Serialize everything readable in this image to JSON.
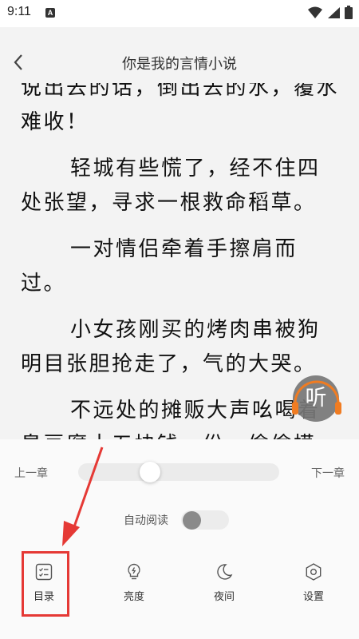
{
  "status_bar": {
    "time": "9:11",
    "notification_letter": "A",
    "icons": [
      "wifi-icon",
      "signal-icon",
      "battery-icon"
    ]
  },
  "header": {
    "title": "你是我的言情小说",
    "back_icon": "chevron-left-icon"
  },
  "reader": {
    "paragraphs": [
      "说出去的话，倒出去的水，覆水难收！",
      "轻城有些慌了，经不住四处张望，寻求一根救命稻草。",
      "一对情侣牵着手擦肩而过。",
      "小女孩刚买的烤肉串被狗明目张胆抢走了，气的大哭。",
      "不远处的摊贩大声吆喝着臭豆腐十五块钱一份，偷偷摸"
    ]
  },
  "listen_button": {
    "label": "听",
    "accent_color": "#f07c22"
  },
  "panel": {
    "prev_chapter": "上一章",
    "next_chapter": "下一章",
    "progress": 0.34,
    "auto_read_label": "自动阅读",
    "auto_read_enabled": false
  },
  "toolbar": {
    "items": [
      {
        "label": "目录",
        "icon": "table-of-contents-icon"
      },
      {
        "label": "亮度",
        "icon": "lightbulb-icon"
      },
      {
        "label": "夜间",
        "icon": "moon-icon"
      },
      {
        "label": "设置",
        "icon": "settings-icon"
      }
    ]
  },
  "annotation": {
    "color": "#e53935"
  }
}
